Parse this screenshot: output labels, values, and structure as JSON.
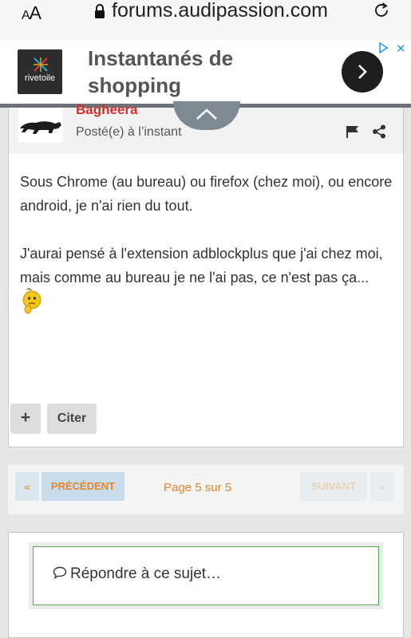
{
  "browser": {
    "text_size_label": "AA",
    "url": "forums.audipassion.com"
  },
  "ad": {
    "brand_name": "rivetoile",
    "headline": "Instantanés de shopping"
  },
  "post": {
    "author": "Bagheera",
    "posted_time": "Posté(e) à l’instant",
    "paragraphs": [
      "Sous Chrome (au bureau) ou firefox (chez moi), ou encore android, je n'ai rien du tout.",
      "J'aurai pensé à l'extension adblockplus que j'ai chez moi, mais comme au bureau je ne l'ai pas, ce n'est pas ça..."
    ],
    "multiquote_label": "+",
    "quote_label": "Citer"
  },
  "pagination": {
    "first_label": "«",
    "prev_label": "PRÉCÉDENT",
    "page_info": "Page 5 sur 5",
    "next_label": "SUIVANT",
    "last_label": "»",
    "current_page": 5,
    "total_pages": 5
  },
  "reply": {
    "prompt": "Répondre à ce sujet…"
  },
  "colors": {
    "author": "#d32f2f",
    "pagination_accent": "#e6862a",
    "reply_border": "#5aa45a",
    "ad_close": "#2a9be0"
  }
}
